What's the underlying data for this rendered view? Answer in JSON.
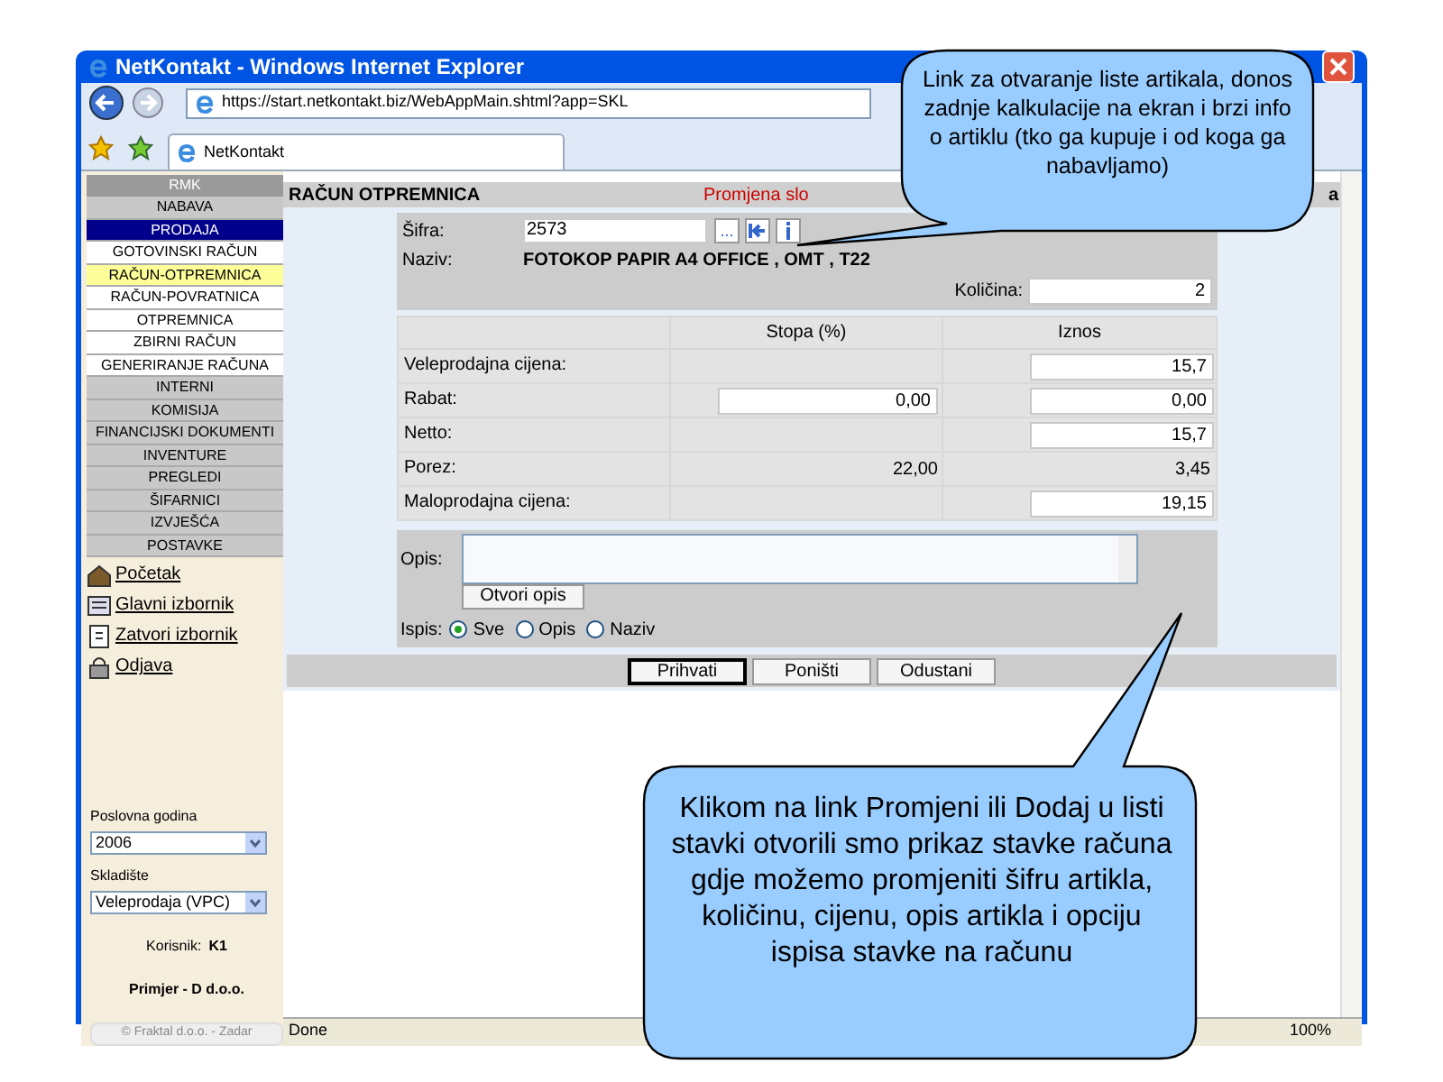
{
  "window": {
    "title": "NetKontakt - Windows Internet Explorer"
  },
  "browser": {
    "address": "https://start.netkontakt.biz/WebAppMain.shtml?app=SKL",
    "tab": "NetKontakt"
  },
  "sidebar": {
    "heading": "RMK",
    "menu": [
      {
        "label": "NABAVA",
        "kind": "section",
        "selected": false
      },
      {
        "label": "PRODAJA",
        "kind": "section",
        "selected": true
      },
      {
        "label": "GOTOVINSKI RAČUN",
        "kind": "subitem",
        "selected": false
      },
      {
        "label": "RAČUN-OTPREMNICA",
        "kind": "subitem",
        "selected": true
      },
      {
        "label": "RAČUN-POVRATNICA",
        "kind": "subitem",
        "selected": false
      },
      {
        "label": "OTPREMNICA",
        "kind": "subitem",
        "selected": false
      },
      {
        "label": "ZBIRNI RAČUN",
        "kind": "subitem",
        "selected": false
      },
      {
        "label": "GENERIRANJE RAČUNA",
        "kind": "subitem",
        "selected": false
      },
      {
        "label": "INTERNI",
        "kind": "section",
        "selected": false
      },
      {
        "label": "KOMISIJA",
        "kind": "section",
        "selected": false
      },
      {
        "label": "FINANCIJSKI DOKUMENTI",
        "kind": "section",
        "selected": false
      },
      {
        "label": "INVENTURE",
        "kind": "section",
        "selected": false
      },
      {
        "label": "PREGLEDI",
        "kind": "section",
        "selected": false
      },
      {
        "label": "ŠIFARNICI",
        "kind": "section",
        "selected": false
      },
      {
        "label": "IZVJEŠĆA",
        "kind": "section",
        "selected": false
      },
      {
        "label": "POSTAVKE",
        "kind": "section",
        "selected": false
      }
    ],
    "links": [
      "Početak",
      "Glavni izbornik",
      "Zatvori izbornik",
      "Odjava"
    ],
    "year": {
      "label": "Poslovna godina",
      "value": "2006"
    },
    "warehouse": {
      "label": "Skladište",
      "value": "Veleprodaja (VPC)"
    },
    "user": {
      "label": "Korisnik:",
      "value": "K1"
    },
    "company": "Primjer - D d.o.o.",
    "copyright": "© Fraktal d.o.o. - Zadar"
  },
  "document": {
    "title": "RAČUN OTPREMNICA",
    "status": "Promjena slo",
    "right_fragment": "a"
  },
  "item": {
    "code_label": "Šifra:",
    "code": "2573",
    "browse_button": "...",
    "name_label": "Naziv:",
    "name": "FOTOKOP PAPIR A4 OFFICE , OMT , T22",
    "qty_label": "Količina:",
    "qty": "2"
  },
  "prices": {
    "columns": [
      "Stopa (%)",
      "Iznos"
    ],
    "rows": [
      {
        "label": "Veleprodajna cijena:",
        "amount": "15,7",
        "amount_editable": true
      },
      {
        "label": "Rabat:",
        "rate": "0,00",
        "rate_editable": true,
        "amount": "0,00",
        "amount_editable": true
      },
      {
        "label": "Netto:",
        "amount": "15,7",
        "amount_editable": true
      },
      {
        "label": "Porez:",
        "rate": "22,00",
        "rate_editable": false,
        "amount": "3,45",
        "amount_editable": false
      },
      {
        "label": "Maloprodajna cijena:",
        "amount": "19,15",
        "amount_editable": true
      }
    ]
  },
  "description": {
    "label": "Opis:",
    "button": "Otvori opis"
  },
  "print": {
    "label": "Ispis:",
    "options": [
      {
        "label": "Sve",
        "selected": true
      },
      {
        "label": "Opis",
        "selected": false
      },
      {
        "label": "Naziv",
        "selected": false
      }
    ]
  },
  "actions": [
    {
      "label": "Prihvati",
      "default": true
    },
    {
      "label": "Poništi",
      "default": false
    },
    {
      "label": "Odustani",
      "default": false
    }
  ],
  "status_bar": {
    "text": "Done",
    "zoom": "100%"
  },
  "callouts": [
    {
      "text": "Link za otvaranje liste artikala, donos zadnje kalkulacije na ekran i brzi info o artiklu (tko ga kupuje i od koga ga nabavljamo)"
    },
    {
      "text": "Klikom na link Promjeni ili Dodaj u listi stavki otvorili smo prikaz stavke računa gdje možemo promjeniti šifru artikla, količinu, cijenu, opis artikla i opciju ispisa stavke na računu"
    }
  ]
}
